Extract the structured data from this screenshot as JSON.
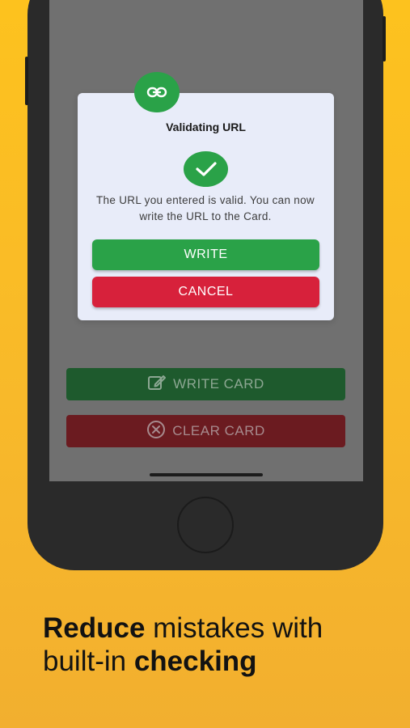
{
  "dialog": {
    "title": "Validating URL",
    "message": "The URL you entered is valid. You can now write the URL to the Card.",
    "write_label": "WRITE",
    "cancel_label": "CANCEL",
    "badge_icon": "link-icon",
    "status_icon": "check-icon"
  },
  "background_actions": {
    "write_card_label": "WRITE CARD",
    "write_card_icon": "edit-icon",
    "clear_card_label": "CLEAR CARD",
    "clear_card_icon": "close-circle-icon"
  },
  "headline": {
    "bold_1": "Reduce",
    "normal_1": " mistakes with",
    "normal_2": "built-in ",
    "bold_2": "checking"
  },
  "colors": {
    "background": "#fdc21e",
    "success": "#2aa248",
    "danger": "#d7213b",
    "dialog_bg": "#e8ecf9",
    "screen_overlay": "#707070"
  }
}
